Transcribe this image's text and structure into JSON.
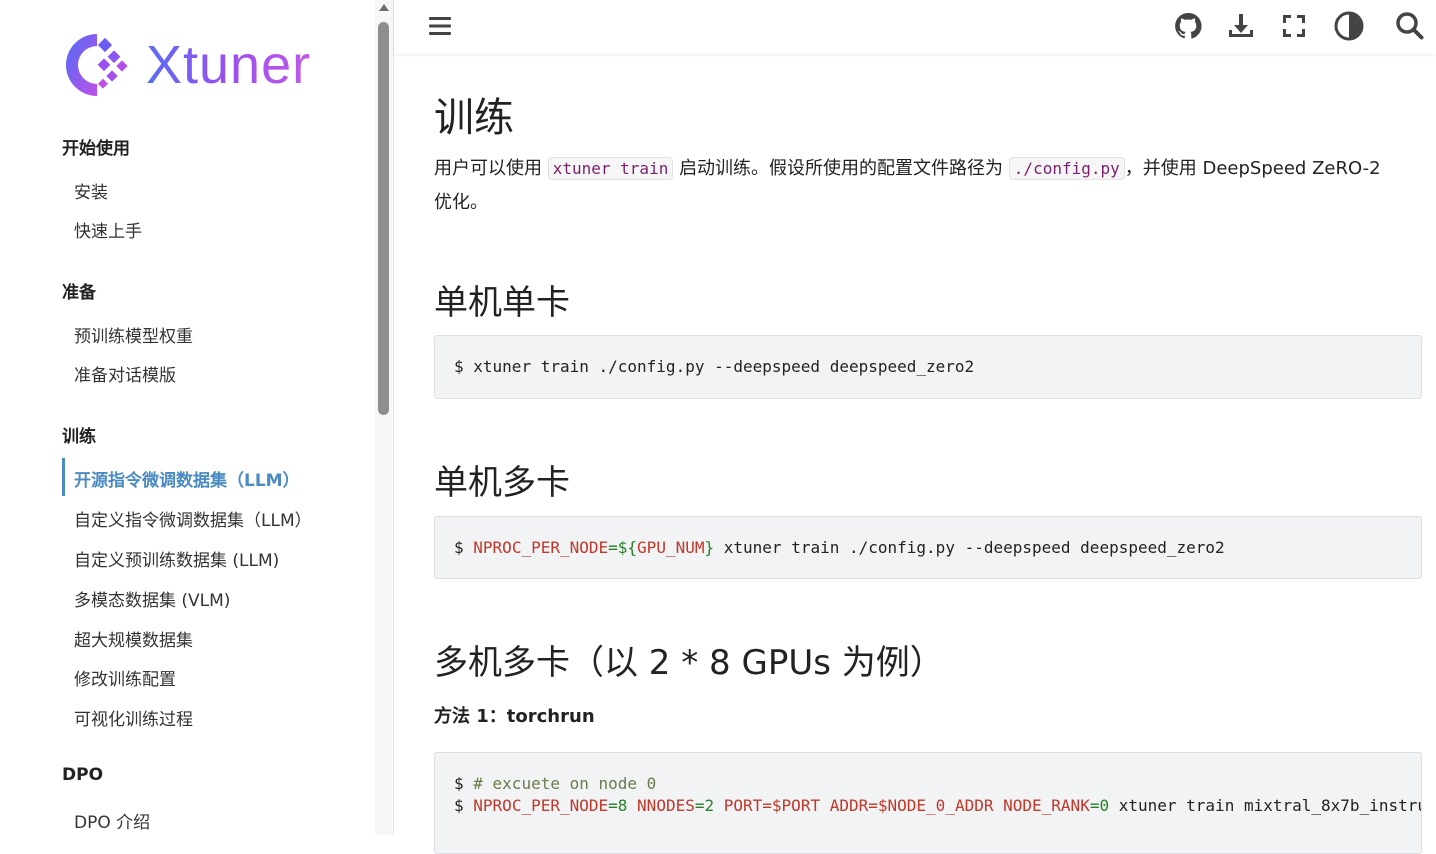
{
  "brand": {
    "name": "Xtuner"
  },
  "sidebar": {
    "sections": [
      {
        "title": "开始使用",
        "items": [
          "安装",
          "快速上手"
        ]
      },
      {
        "title": "准备",
        "items": [
          "预训练模型权重",
          "准备对话模版"
        ]
      },
      {
        "title": "训练",
        "items": [
          "开源指令微调数据集（LLM）",
          "自定义指令微调数据集（LLM）",
          "自定义预训练数据集 (LLM)",
          "多模态数据集 (VLM)",
          "超大规模数据集",
          "修改训练配置",
          "可视化训练过程"
        ]
      },
      {
        "title": "DPO",
        "items": [
          "DPO 介绍"
        ]
      }
    ],
    "active_item": "开源指令微调数据集（LLM）"
  },
  "header": {
    "icons": [
      "menu-icon",
      "github-icon",
      "download-icon",
      "fullscreen-icon",
      "theme-toggle-icon",
      "search-icon"
    ]
  },
  "page": {
    "title": "训练",
    "intro_prefix": "用户可以使用",
    "intro_code1": "xtuner train",
    "intro_mid": "启动训练。假设所使用的配置文件路径为",
    "intro_code2": "./config.py",
    "intro_suffix": "，并使用 DeepSpeed ZeRO-2 优化。",
    "sections": [
      {
        "heading": "单机单卡"
      },
      {
        "heading": "单机多卡"
      },
      {
        "heading": "多机多卡（以 2 * 8 GPUs 为例）"
      }
    ],
    "code1": {
      "prompt": "$",
      "cmd": " xtuner train ./config.py --deepspeed deepspeed_zero2"
    },
    "code2": {
      "prompt": "$",
      "var": "NPROC_PER_NODE",
      "eq": "=",
      "open": "${",
      "inner": "GPU_NUM",
      "close": "}",
      "cmd": " xtuner train ./config.py --deepspeed deepspeed_zero2"
    },
    "method1": "方法 1：torchrun",
    "code3": {
      "line1_prompt": "$",
      "line1_comment": " # excuete on node 0",
      "line2_prompt": "$",
      "line2_v1": "NPROC_PER_NODE",
      "line2_e1": "=8",
      "line2_v2": "NNODES",
      "line2_e2": "=2",
      "line2_v3": "PORT",
      "line2_e3": "=$PORT",
      "line2_v4": "ADDR",
      "line2_e4": "=$NODE_0_ADDR",
      "line2_v5": "NODE_RANK",
      "line2_e5": "=0",
      "line2_cmd": " xtuner train mixtral_8x7b_instru"
    }
  }
}
